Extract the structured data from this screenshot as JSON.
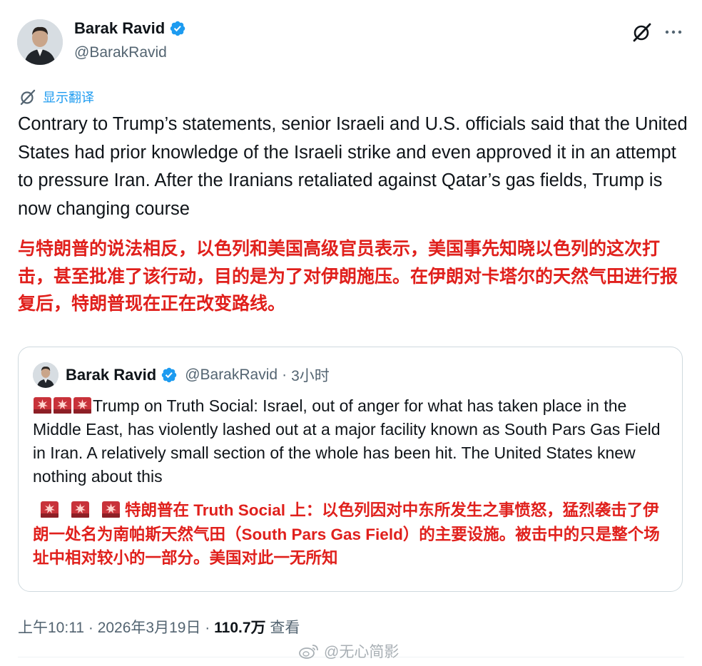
{
  "author": {
    "name": "Barak Ravid",
    "handle": "@BarakRavid"
  },
  "translate_label": "显示翻译",
  "tweet_text": "Contrary to Trump’s statements, senior Israeli and U.S. officials said that the United States had prior knowledge of the Israeli strike and even approved it in an attempt to pressure Iran. After the Iranians retaliated against Qatar’s gas fields, Trump is now changing course",
  "tweet_text_zh": "与特朗普的说法相反，以色列和美国高级官员表示，美国事先知晓以色列的这次打击，甚至批准了该行动，目的是为了对伊朗施压。在伊朗对卡塔尔的天然气田进行报复后，特朗普现在正在改变路线。",
  "quote": {
    "name": "Barak Ravid",
    "handle": "@BarakRavid",
    "separator": "·",
    "time": "3小时",
    "text": "Trump on Truth Social: Israel, out of anger for what has taken place in the Middle East, has violently lashed out at a major facility known as South Pars Gas Field in Iran. A relatively small section of the whole has been hit. The United States knew nothing about this",
    "text_zh": "特朗普在 Truth Social 上：以色列因对中东所发生之事愤怒，猛烈袭击了伊朗一处名为南帕斯天然气田（South Pars Gas Field）的主要设施。被击中的只是整个场址中相对较小的一部分。美国对此一无所知"
  },
  "meta": {
    "time": "上午10:11",
    "sep1": "·",
    "date": "2026年3月19日",
    "sep2": "·",
    "views": "110.7万",
    "views_label": "查看"
  },
  "watermark": "@无心简影",
  "colors": {
    "accent": "#1d9bf0",
    "translation_red": "#e0201c",
    "secondary_text": "#536471"
  }
}
